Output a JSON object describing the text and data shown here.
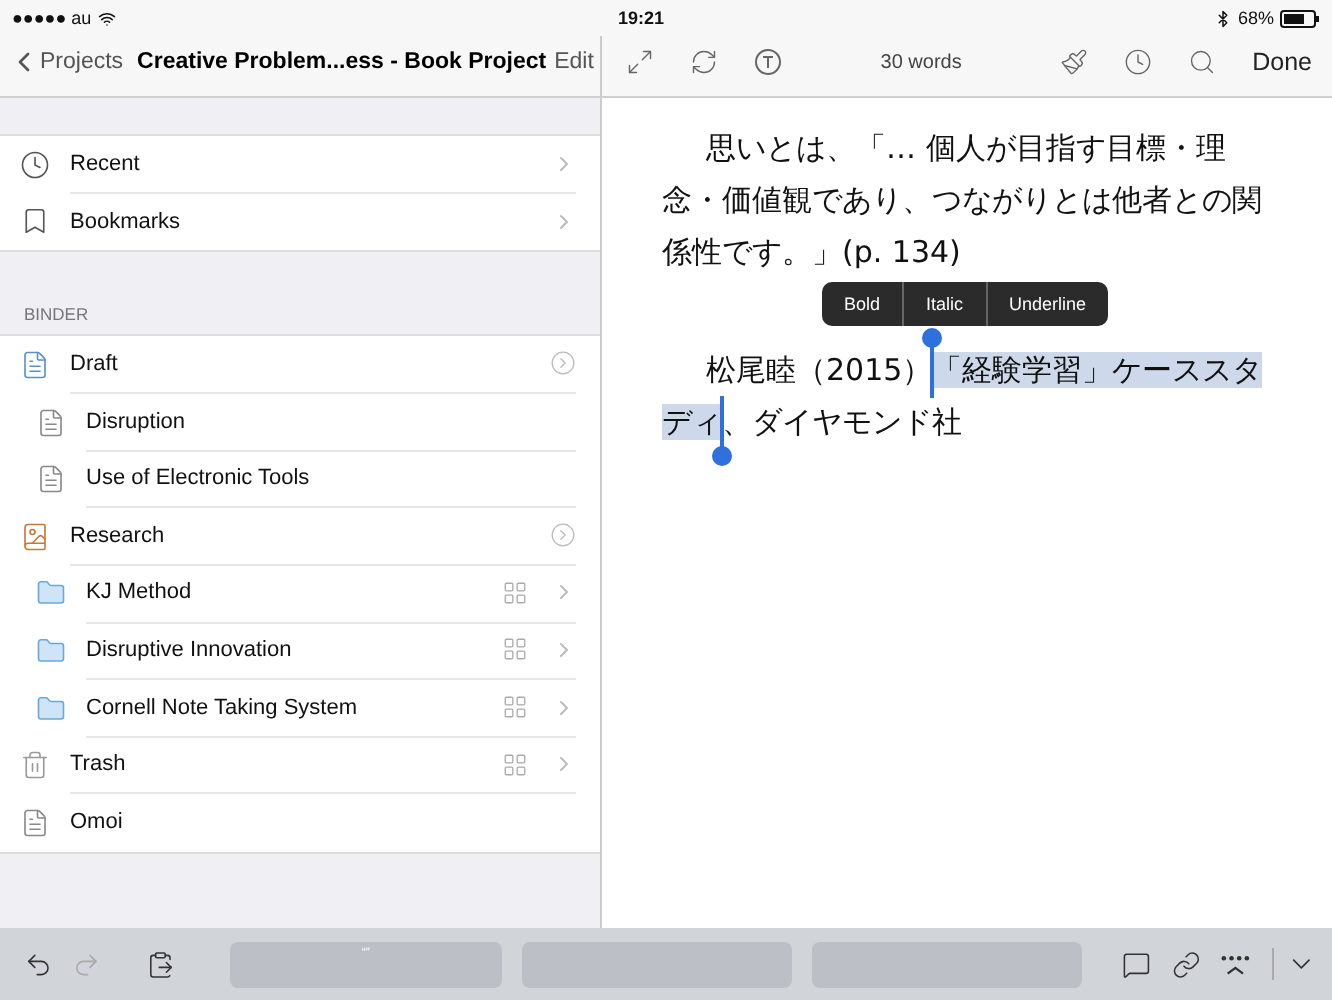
{
  "status_bar": {
    "carrier": "●●●●● au",
    "time": "19:21",
    "battery": "68%"
  },
  "sidebar": {
    "back": "Projects",
    "title": "Creative Problem...ess - Book Project",
    "edit": "Edit",
    "shortcuts": [
      {
        "label": "Recent",
        "kind": "recent"
      },
      {
        "label": "Bookmarks",
        "kind": "bookmarks"
      }
    ],
    "section": "BINDER",
    "binder": [
      {
        "label": "Draft",
        "kind": "draft",
        "info_button": true,
        "grid_button": false,
        "children": [
          {
            "label": "Disruption",
            "kind": "document",
            "info_button": false,
            "grid_button": false
          },
          {
            "label": "Use of Electronic Tools",
            "kind": "document",
            "info_button": false,
            "grid_button": false
          }
        ]
      },
      {
        "label": "Research",
        "kind": "research",
        "info_button": true,
        "grid_button": false,
        "children": [
          {
            "label": "KJ Method",
            "kind": "folder",
            "info_button": false,
            "grid_button": true
          },
          {
            "label": "Disruptive Innovation",
            "kind": "folder",
            "info_button": false,
            "grid_button": true
          },
          {
            "label": "Cornell Note Taking System",
            "kind": "folder",
            "info_button": false,
            "grid_button": true
          }
        ]
      },
      {
        "label": "Trash",
        "kind": "trash",
        "info_button": false,
        "grid_button": true
      },
      {
        "label": "Omoi",
        "kind": "document",
        "info_button": false,
        "grid_button": false
      }
    ]
  },
  "editor": {
    "word_count": "30 words",
    "done": "Done",
    "paragraphs": [
      [
        {
          "text": "思いとは、「… 個人が目指す目標・理念・価値観であり、つながりとは他者との関係性です。」(p. 134)",
          "selected": false
        }
      ],
      [
        {
          "text": "松尾睦（2015）",
          "selected": false
        },
        {
          "text": "「経験学習」ケーススタディ",
          "selected": true
        },
        {
          "text": "、ダイヤモンド社",
          "selected": false
        }
      ]
    ],
    "popup_menu": [
      "Bold",
      "Italic",
      "Underline"
    ]
  },
  "keyboard_bar": {
    "suggestions": [
      {
        "kind": "text",
        "text": "“”"
      },
      {
        "kind": "empty"
      },
      {
        "kind": "empty"
      }
    ]
  }
}
